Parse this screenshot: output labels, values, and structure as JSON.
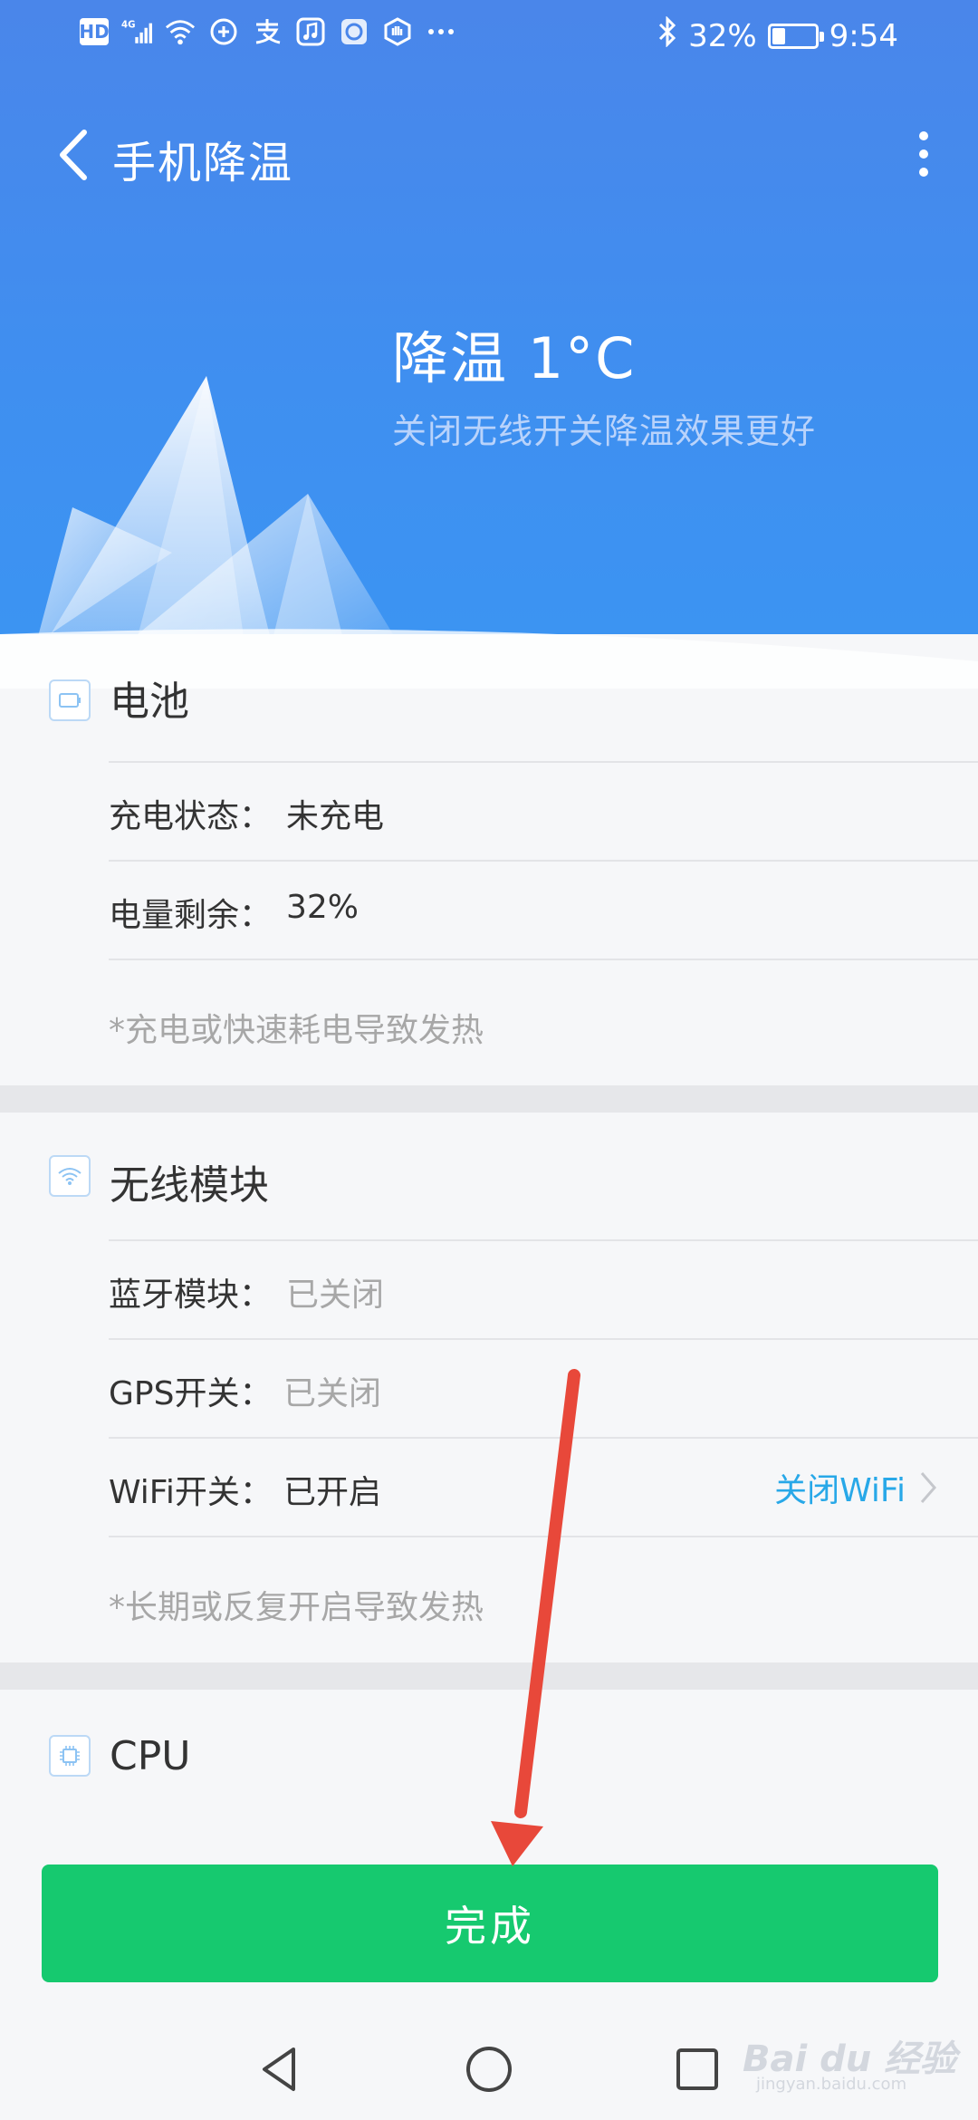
{
  "status_bar": {
    "left_icons": [
      "hd-icon",
      "signal-4g-icon",
      "wifi-icon",
      "qq-icon",
      "alipay-icon",
      "music-icon",
      "app-icon",
      "hand-icon",
      "more-dots-icon"
    ],
    "hd_label": "HD",
    "network_label": "4G",
    "battery_percent": "32%",
    "battery_level": 0.32,
    "time": "9:54"
  },
  "app_bar": {
    "title": "手机降温"
  },
  "hero": {
    "title": "降温 1°C",
    "subtitle": "关闭无线开关降温效果更好"
  },
  "battery_section": {
    "title": "电池",
    "rows": [
      {
        "label": "充电状态：",
        "value": "未充电"
      },
      {
        "label": "电量剩余：",
        "value": "32%"
      }
    ],
    "note": "*充电或快速耗电导致发热"
  },
  "wireless_section": {
    "title": "无线模块",
    "rows": [
      {
        "label": "蓝牙模块：",
        "value": "已关闭"
      },
      {
        "label": "GPS开关：",
        "value": "已关闭"
      },
      {
        "label": "WiFi开关：",
        "value": "已开启",
        "action": "关闭WiFi"
      }
    ],
    "note": "*长期或反复开启导致发热"
  },
  "cpu_section": {
    "title": "CPU"
  },
  "done_button": "完成",
  "watermark": {
    "brand": "Bai du 经验",
    "url": "jingyan.baidu.com"
  },
  "colors": {
    "header_blue": "#4a86ea",
    "done_green": "#16c96f",
    "link_blue": "#28a8e8",
    "annotation_red": "#e8483a"
  }
}
